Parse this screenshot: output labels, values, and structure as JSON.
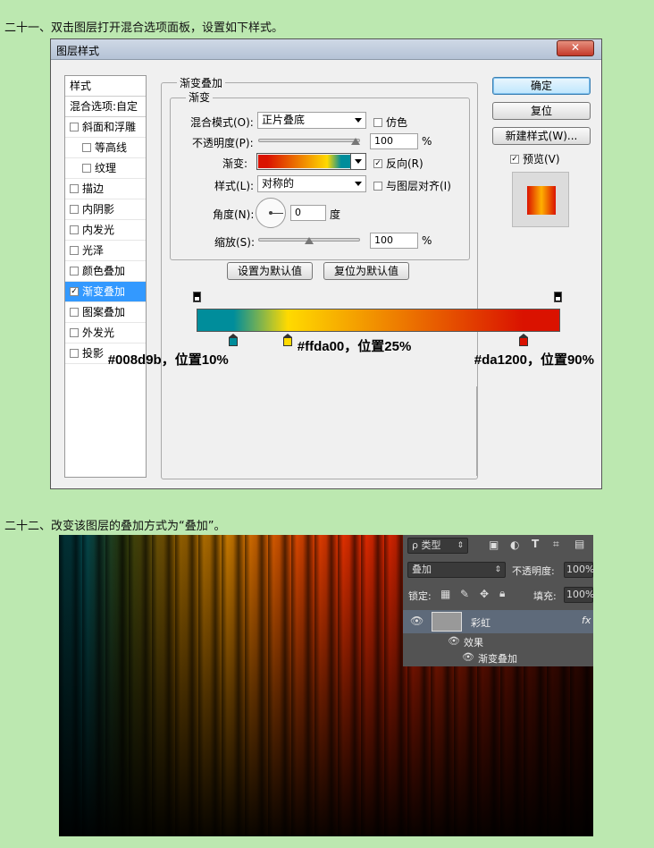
{
  "captions": {
    "step21": "二十一、双击图层打开混合选项面板，设置如下样式。",
    "step22": "二十二、改变该图层的叠加方式为“叠加”。"
  },
  "dialog": {
    "title": "图层样式",
    "close_glyph": "✕",
    "style_list": [
      {
        "label": "样式",
        "checkbox": false,
        "checked": false,
        "selected": false,
        "header": true
      },
      {
        "label": "混合选项:自定",
        "checkbox": false,
        "checked": false,
        "selected": false,
        "header": true
      },
      {
        "label": "斜面和浮雕",
        "checkbox": true,
        "checked": false,
        "selected": false
      },
      {
        "label": "等高线",
        "checkbox": true,
        "checked": false,
        "selected": false,
        "indent": true
      },
      {
        "label": "纹理",
        "checkbox": true,
        "checked": false,
        "selected": false,
        "indent": true
      },
      {
        "label": "描边",
        "checkbox": true,
        "checked": false,
        "selected": false
      },
      {
        "label": "内阴影",
        "checkbox": true,
        "checked": false,
        "selected": false
      },
      {
        "label": "内发光",
        "checkbox": true,
        "checked": false,
        "selected": false
      },
      {
        "label": "光泽",
        "checkbox": true,
        "checked": false,
        "selected": false
      },
      {
        "label": "颜色叠加",
        "checkbox": true,
        "checked": false,
        "selected": false
      },
      {
        "label": "渐变叠加",
        "checkbox": true,
        "checked": true,
        "selected": true
      },
      {
        "label": "图案叠加",
        "checkbox": true,
        "checked": false,
        "selected": false
      },
      {
        "label": "外发光",
        "checkbox": true,
        "checked": false,
        "selected": false
      },
      {
        "label": "投影",
        "checkbox": true,
        "checked": false,
        "selected": false
      }
    ],
    "section_title": "渐变叠加",
    "subsection_title": "渐变",
    "blend_mode_label": "混合模式(O):",
    "blend_mode_value": "正片叠底",
    "dither_label": "仿色",
    "opacity_label": "不透明度(P):",
    "opacity_value": "100",
    "opacity_unit": "%",
    "opacity_level": 1.0,
    "gradient_label": "渐变:",
    "reverse_label": "反向(R)",
    "reverse_checked": true,
    "style_label": "样式(L):",
    "style_value": "对称的",
    "align_label": "与图层对齐(I)",
    "angle_label": "角度(N):",
    "angle_value": "0",
    "angle_unit": "度",
    "scale_label": "缩放(S):",
    "scale_value": "100",
    "scale_unit": "%",
    "scale_level": 0.5,
    "set_default_btn": "设置为默认值",
    "reset_default_btn": "复位为默认值",
    "ok_btn": "确定",
    "reset_btn": "复位",
    "new_style_btn": "新建样式(W)...",
    "preview_label": "预览(V)",
    "preview_checked": true,
    "check_mark": "✓"
  },
  "gradient_editor": {
    "stops": [
      {
        "color": "#008d9b",
        "position": 10,
        "label": "#008d9b，位置10%"
      },
      {
        "color": "#ffda00",
        "position": 25,
        "label": "#ffda00，位置25%"
      },
      {
        "color": "#da1200",
        "position": 90,
        "label": "#da1200，位置90%"
      }
    ]
  },
  "layers_panel": {
    "filter_label": "ρ 类型",
    "blend_mode": "叠加",
    "opacity_label": "不透明度:",
    "opacity_value": "100%",
    "lock_label": "锁定:",
    "fill_label": "填充:",
    "fill_value": "100%",
    "layer_name": "彩虹",
    "effects_label": "效果",
    "effect_item": "渐变叠加",
    "fx_label": "fx"
  }
}
